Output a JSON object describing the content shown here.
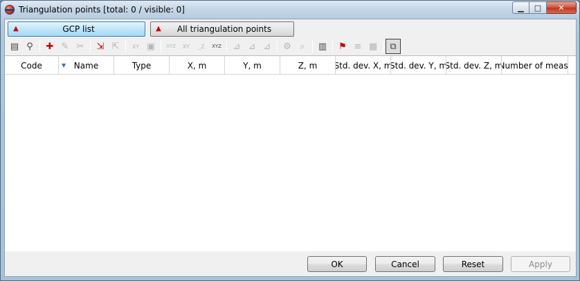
{
  "window": {
    "title": "Triangulation points [total: 0 / visible: 0]",
    "caption_buttons": {
      "minimize": "▁",
      "maximize": "□",
      "close": "✕"
    }
  },
  "modes": [
    {
      "label": "GCP list",
      "icon": "gcp-list-icon",
      "active": true
    },
    {
      "label": "All triangulation points",
      "icon": "all-points-icon",
      "active": false
    }
  ],
  "toolbar": [
    {
      "name": "report-icon",
      "glyph": "▤",
      "enabled": true
    },
    {
      "name": "binoculars-icon",
      "glyph": "⚲",
      "enabled": true
    },
    {
      "sep": true
    },
    {
      "name": "add-point-icon",
      "glyph": "✚",
      "enabled": true
    },
    {
      "name": "edit-point-icon",
      "glyph": "✎",
      "enabled": false
    },
    {
      "name": "delete-point-icon",
      "glyph": "✂",
      "enabled": false
    },
    {
      "sep": true
    },
    {
      "name": "import-icon",
      "glyph": "⇲",
      "enabled": true
    },
    {
      "name": "export-icon",
      "glyph": "⇱",
      "enabled": false
    },
    {
      "sep": true
    },
    {
      "name": "swap-xy-icon",
      "glyph": "XY",
      "enabled": false
    },
    {
      "name": "transform-icon",
      "glyph": "▣",
      "enabled": false
    },
    {
      "sep": true
    },
    {
      "name": "xyz-icon",
      "glyph": "XYZ",
      "enabled": false
    },
    {
      "name": "xy-icon",
      "glyph": "XY",
      "enabled": false
    },
    {
      "name": "z-icon",
      "glyph": "_Z",
      "enabled": false
    },
    {
      "name": "xyz-active-icon",
      "glyph": "XYZ",
      "enabled": true
    },
    {
      "sep": true
    },
    {
      "name": "measure-point-icon",
      "glyph": "⊿",
      "enabled": false
    },
    {
      "name": "measure-point-2-icon",
      "glyph": "⊿",
      "enabled": false
    },
    {
      "name": "measure-point-3-icon",
      "glyph": "⊿",
      "enabled": false
    },
    {
      "sep": true
    },
    {
      "name": "settings-icon",
      "glyph": "⚙",
      "enabled": false
    },
    {
      "name": "zoom-icon",
      "glyph": "⌕",
      "enabled": false
    },
    {
      "sep": true
    },
    {
      "name": "document-icon",
      "glyph": "▥",
      "enabled": true
    },
    {
      "sep": true
    },
    {
      "name": "folder-flag-icon",
      "glyph": "⚑",
      "enabled": true
    },
    {
      "name": "list-z-icon",
      "glyph": "≡",
      "enabled": false
    },
    {
      "name": "list-flag-icon",
      "glyph": "▦",
      "enabled": false
    },
    {
      "sep": true
    },
    {
      "name": "filter-toggle-icon",
      "glyph": "⧉",
      "enabled": true,
      "pressed": true
    }
  ],
  "table": {
    "columns": [
      {
        "label": "Code"
      },
      {
        "label": "Name",
        "sorted": true,
        "sort_glyph": "▼"
      },
      {
        "label": "Type"
      },
      {
        "label": "X, m"
      },
      {
        "label": "Y, m"
      },
      {
        "label": "Z, m"
      },
      {
        "label": "Std. dev. X, m"
      },
      {
        "label": "Std. dev. Y, m"
      },
      {
        "label": "Std. dev. Z, m"
      },
      {
        "label": "Number of meas."
      }
    ],
    "rows": []
  },
  "buttons": [
    {
      "label": "OK",
      "enabled": true
    },
    {
      "label": "Cancel",
      "enabled": true
    },
    {
      "label": "Reset",
      "enabled": true
    },
    {
      "label": "Apply",
      "enabled": false
    }
  ],
  "colors": {
    "active_mode": "#bfe6f9",
    "icon_red": "#c40000",
    "icon_orange": "#e28a00"
  }
}
